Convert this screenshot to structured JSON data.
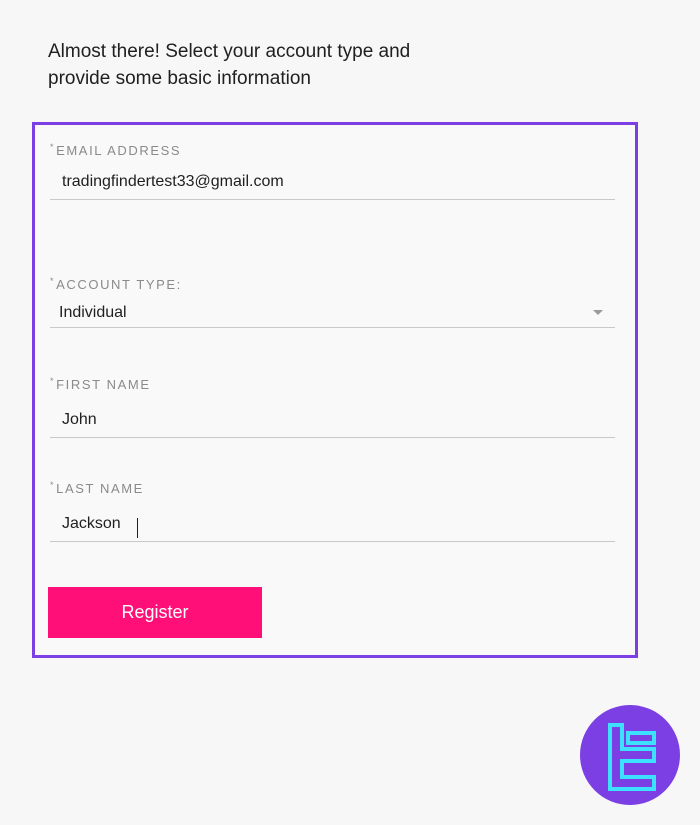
{
  "heading": {
    "line1": "Almost there! Select your account type and",
    "line2": "provide some basic information"
  },
  "form": {
    "email": {
      "label": "EMAIL ADDRESS",
      "value": "tradingfindertest33@gmail.com"
    },
    "account_type": {
      "label": "ACCOUNT TYPE:",
      "value": "Individual"
    },
    "first_name": {
      "label": "FIRST NAME",
      "value": "John"
    },
    "last_name": {
      "label": "LAST NAME",
      "value": "Jackson"
    },
    "required_marker": "*",
    "register_label": "Register"
  },
  "colors": {
    "frame": "#7b3fe4",
    "button": "#ff0f77",
    "logo_bg": "#7b3fe4",
    "logo_mark": "#3de0ff"
  },
  "icons": {
    "dropdown": "chevron-down-icon",
    "logo": "brand-logo-icon"
  }
}
